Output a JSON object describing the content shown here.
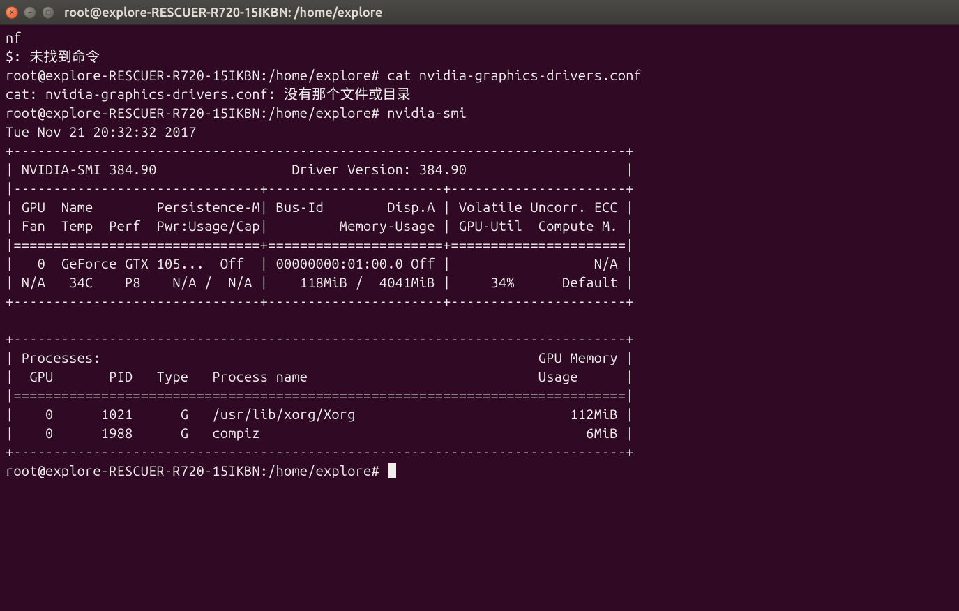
{
  "window": {
    "title": "root@explore-RESCUER-R720-15IKBN: /home/explore"
  },
  "term": {
    "line1": "nf",
    "line2": "$: 未找到命令",
    "line3": "root@explore-RESCUER-R720-15IKBN:/home/explore# cat nvidia-graphics-drivers.conf",
    "line4": "cat: nvidia-graphics-drivers.conf: 没有那个文件或目录",
    "line5": "root@explore-RESCUER-R720-15IKBN:/home/explore# nvidia-smi",
    "line6": "Tue Nov 21 20:32:32 2017       ",
    "smi": {
      "border_top": "+-----------------------------------------------------------------------------+",
      "version_row": "| NVIDIA-SMI 384.90                 Driver Version: 384.90                    |",
      "sep1": "|-------------------------------+----------------------+----------------------+",
      "hdr1": "| GPU  Name        Persistence-M| Bus-Id        Disp.A | Volatile Uncorr. ECC |",
      "hdr2": "| Fan  Temp  Perf  Pwr:Usage/Cap|         Memory-Usage | GPU-Util  Compute M. |",
      "sep2": "|===============================+======================+======================|",
      "gpu_row1": "|   0  GeForce GTX 105...  Off  | 00000000:01:00.0 Off |                  N/A |",
      "gpu_row2": "| N/A   34C    P8    N/A /  N/A |    118MiB /  4041MiB |     34%      Default |",
      "border_mid": "+-------------------------------+----------------------+----------------------+",
      "blank": "                                                                               ",
      "proc_top": "+-----------------------------------------------------------------------------+",
      "proc_hdr1": "| Processes:                                                       GPU Memory |",
      "proc_hdr2": "|  GPU       PID   Type   Process name                             Usage      |",
      "proc_sep": "|=============================================================================|",
      "proc_row1": "|    0      1021      G   /usr/lib/xorg/Xorg                           112MiB |",
      "proc_row2": "|    0      1988      G   compiz                                         6MiB |",
      "proc_bot": "+-----------------------------------------------------------------------------+"
    },
    "prompt": "root@explore-RESCUER-R720-15IKBN:/home/explore# "
  },
  "nvidia_smi_data": {
    "timestamp": "Tue Nov 21 20:32:32 2017",
    "smi_version": "384.90",
    "driver_version": "384.90",
    "gpus": [
      {
        "index": 0,
        "name": "GeForce GTX 105...",
        "persistence_m": "Off",
        "bus_id": "00000000:01:00.0",
        "disp_a": "Off",
        "ecc": "N/A",
        "fan": "N/A",
        "temp_c": 34,
        "perf": "P8",
        "pwr_usage": "N/A",
        "pwr_cap": "N/A",
        "mem_used_mib": 118,
        "mem_total_mib": 4041,
        "gpu_util_pct": 34,
        "compute_mode": "Default"
      }
    ],
    "processes": [
      {
        "gpu": 0,
        "pid": 1021,
        "type": "G",
        "name": "/usr/lib/xorg/Xorg",
        "mem_mib": 112
      },
      {
        "gpu": 0,
        "pid": 1988,
        "type": "G",
        "name": "compiz",
        "mem_mib": 6
      }
    ]
  }
}
